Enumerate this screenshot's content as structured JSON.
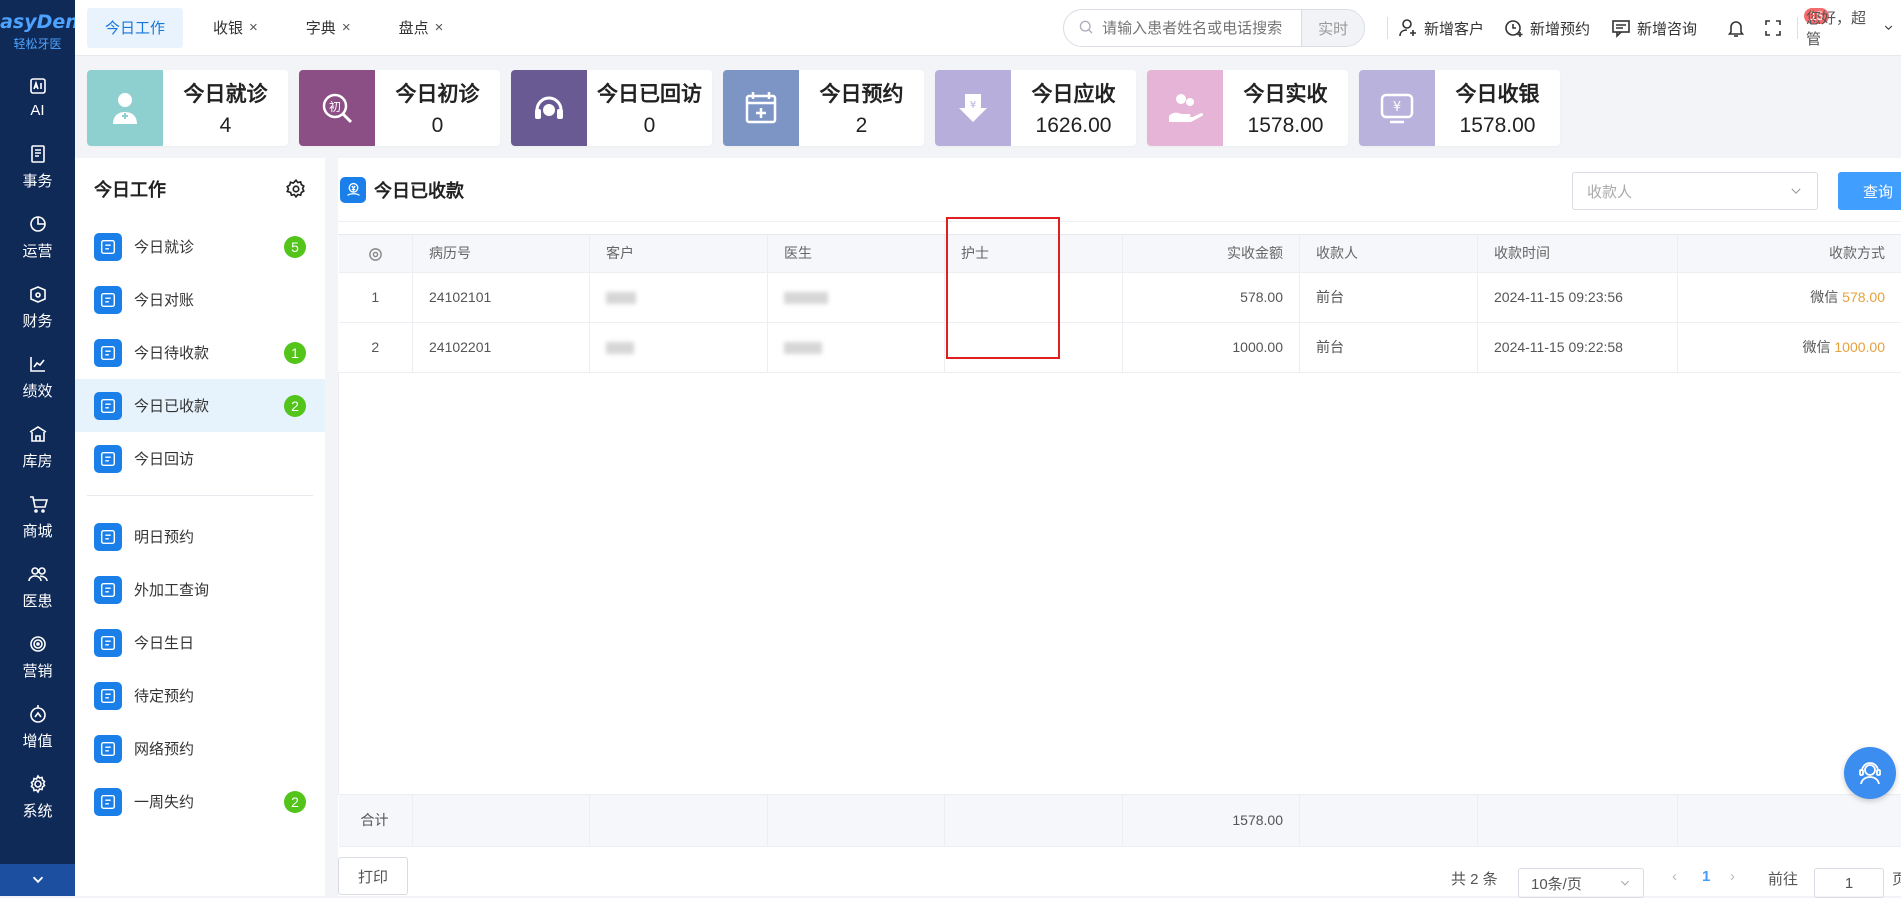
{
  "brand": {
    "name_en": "EasyDent",
    "name_cn": "轻松牙医"
  },
  "left_nav": [
    {
      "label": "AI",
      "icon": "ai-icon"
    },
    {
      "label": "事务",
      "icon": "document-icon"
    },
    {
      "label": "运营",
      "icon": "pie-chart-icon"
    },
    {
      "label": "财务",
      "icon": "wallet-icon"
    },
    {
      "label": "绩效",
      "icon": "line-chart-icon"
    },
    {
      "label": "库房",
      "icon": "warehouse-icon"
    },
    {
      "label": "商城",
      "icon": "cart-icon"
    },
    {
      "label": "医患",
      "icon": "users-icon"
    },
    {
      "label": "营销",
      "icon": "target-icon"
    },
    {
      "label": "增值",
      "icon": "growth-icon"
    },
    {
      "label": "系统",
      "icon": "gear-icon"
    }
  ],
  "tabs": [
    {
      "label": "今日工作",
      "active": true
    },
    {
      "label": "收银",
      "close": "×"
    },
    {
      "label": "字典",
      "close": "×"
    },
    {
      "label": "盘点",
      "close": "×"
    }
  ],
  "search": {
    "placeholder": "请输入患者姓名或电话搜索",
    "mode": "实时"
  },
  "toolbar": {
    "new_customer": "新增客户",
    "new_appointment": "新增预约",
    "new_consult": "新增咨询",
    "notifications": "15",
    "greeting": "您好，超管"
  },
  "cards": [
    {
      "title": "今日就诊",
      "value": "4",
      "color": "#8ecfd0"
    },
    {
      "title": "今日初诊",
      "value": "0",
      "color": "#8b4f86"
    },
    {
      "title": "今日已回访",
      "value": "0",
      "color": "#6a5a94"
    },
    {
      "title": "今日预约",
      "value": "2",
      "color": "#7d95c4"
    },
    {
      "title": "今日应收",
      "value": "1626.00",
      "color": "#b8aedb"
    },
    {
      "title": "今日实收",
      "value": "1578.00",
      "color": "#e6b4d6"
    },
    {
      "title": "今日收银",
      "value": "1578.00",
      "color": "#b9b2dc"
    }
  ],
  "side": {
    "title": "今日工作",
    "items": [
      {
        "label": "今日就诊",
        "count": "5"
      },
      {
        "label": "今日对账",
        "count": ""
      },
      {
        "label": "今日待收款",
        "count": "1"
      },
      {
        "label": "今日已收款",
        "count": "2",
        "active": true
      },
      {
        "label": "今日回访",
        "count": ""
      }
    ],
    "items2": [
      {
        "label": "明日预约",
        "count": ""
      },
      {
        "label": "外加工查询",
        "count": ""
      },
      {
        "label": "今日生日",
        "count": ""
      },
      {
        "label": "待定预约",
        "count": ""
      },
      {
        "label": "网络预约",
        "count": ""
      },
      {
        "label": "一周失约",
        "count": "2"
      }
    ]
  },
  "main": {
    "title": "今日已收款",
    "payee_placeholder": "收款人",
    "query_label": "查询",
    "columns": [
      "",
      "病历号",
      "客户",
      "医生",
      "护士",
      "实收金额",
      "收款人",
      "收款时间",
      "收款方式"
    ],
    "rows": [
      {
        "no": "1",
        "record": "24102101",
        "amount": "578.00",
        "payee": "前台",
        "time": "2024-11-15 09:23:56",
        "method": "微信",
        "method_amount": "578.00"
      },
      {
        "no": "2",
        "record": "24102201",
        "amount": "1000.00",
        "payee": "前台",
        "time": "2024-11-15 09:22:58",
        "method": "微信",
        "method_amount": "1000.00"
      }
    ],
    "total_label": "合计",
    "total_amount": "1578.00"
  },
  "footer": {
    "print": "打印",
    "total": "共 2 条",
    "page_size": "10条/页",
    "current_page": "1",
    "goto_label": "前往",
    "goto_value": "1",
    "page_unit": "页"
  }
}
